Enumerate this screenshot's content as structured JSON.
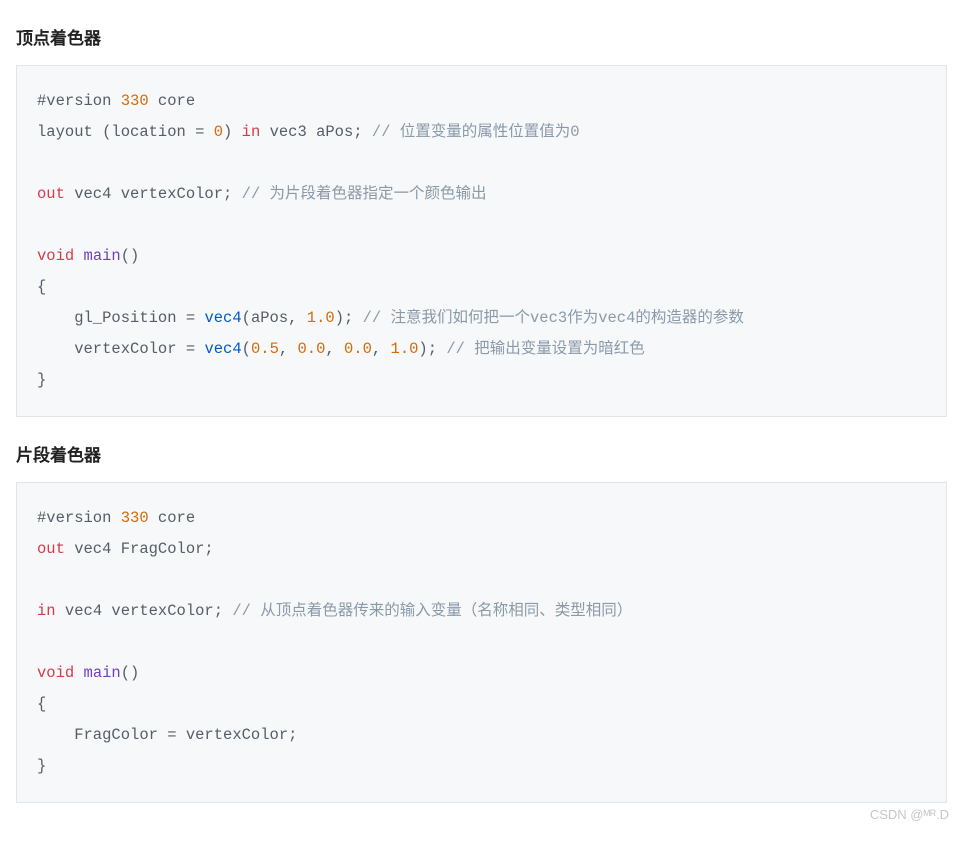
{
  "section1": {
    "title": "顶点着色器",
    "code": {
      "line1_a": "#version ",
      "line1_num": "330",
      "line1_b": " core",
      "line2_a": "layout (location = ",
      "line2_num": "0",
      "line2_b": ") ",
      "line2_in": "in",
      "line2_c": " vec3 aPos; ",
      "line2_comment": "// 位置变量的属性位置值为0",
      "line3_out": "out",
      "line3_a": " vec4 vertexColor; ",
      "line3_comment": "// 为片段着色器指定一个颜色输出",
      "line4_void": "void",
      "line4_sp": " ",
      "line4_main": "main",
      "line4_paren": "()",
      "line5": "{",
      "line6_a": "    gl_Position = ",
      "line6_vec4": "vec4",
      "line6_b": "(aPos, ",
      "line6_num": "1.0",
      "line6_c": "); ",
      "line6_comment": "// 注意我们如何把一个vec3作为vec4的构造器的参数",
      "line7_a": "    vertexColor = ",
      "line7_vec4": "vec4",
      "line7_b": "(",
      "line7_n1": "0.5",
      "line7_c1": ", ",
      "line7_n2": "0.0",
      "line7_c2": ", ",
      "line7_n3": "0.0",
      "line7_c3": ", ",
      "line7_n4": "1.0",
      "line7_d": "); ",
      "line7_comment": "// 把输出变量设置为暗红色",
      "line8": "}"
    }
  },
  "section2": {
    "title": "片段着色器",
    "code": {
      "line1_a": "#version ",
      "line1_num": "330",
      "line1_b": " core",
      "line2_out": "out",
      "line2_a": " vec4 FragColor;",
      "line3_in": "in",
      "line3_a": " vec4 vertexColor; ",
      "line3_comment": "// 从顶点着色器传来的输入变量（名称相同、类型相同）",
      "line4_void": "void",
      "line4_sp": " ",
      "line4_main": "main",
      "line4_paren": "()",
      "line5": "{",
      "line6": "    FragColor = vertexColor;",
      "line7": "}"
    }
  },
  "watermark": "CSDN @ᴹᴿ.D"
}
